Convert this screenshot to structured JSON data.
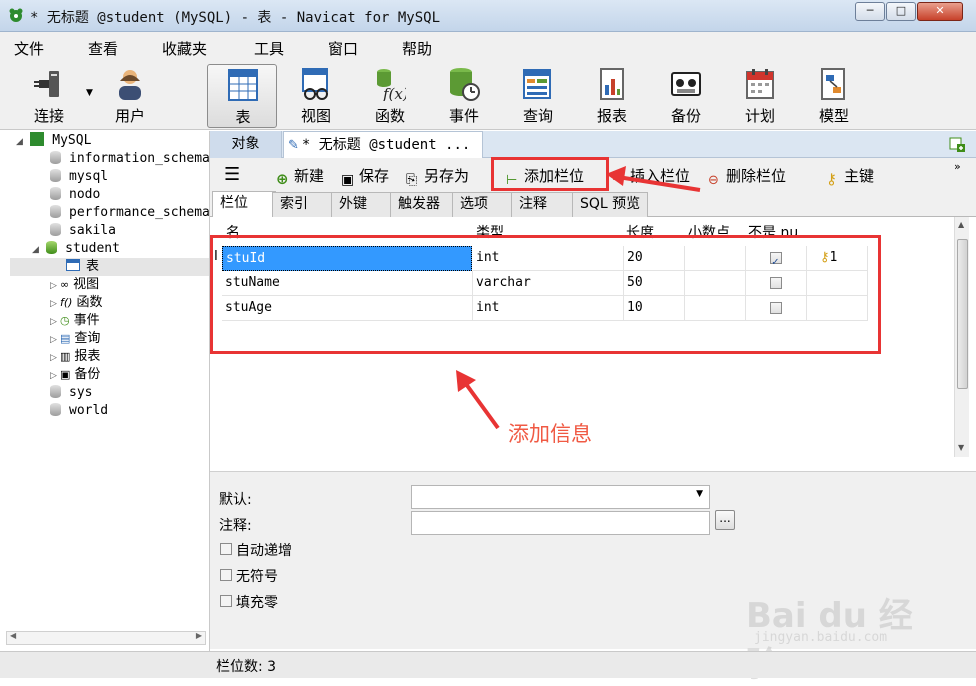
{
  "window": {
    "title": "* 无标题 @student (MySQL) - 表 - Navicat for MySQL",
    "min": "─",
    "max": "□",
    "close": "✕"
  },
  "menu": [
    "文件",
    "查看",
    "收藏夹",
    "工具",
    "窗口",
    "帮助"
  ],
  "toolbar": [
    {
      "label": "连接",
      "icon": "plug-icon"
    },
    {
      "label": "用户",
      "icon": "user-icon"
    },
    {
      "label": "表",
      "icon": "table-icon"
    },
    {
      "label": "视图",
      "icon": "view-icon"
    },
    {
      "label": "函数",
      "icon": "function-icon"
    },
    {
      "label": "事件",
      "icon": "event-icon"
    },
    {
      "label": "查询",
      "icon": "query-icon"
    },
    {
      "label": "报表",
      "icon": "report-icon"
    },
    {
      "label": "备份",
      "icon": "backup-icon"
    },
    {
      "label": "计划",
      "icon": "schedule-icon"
    },
    {
      "label": "模型",
      "icon": "model-icon"
    }
  ],
  "tree": {
    "root": "MySQL",
    "databases": [
      "information_schema",
      "mysql",
      "nodo",
      "performance_schema",
      "sakila",
      "student"
    ],
    "student_children": [
      "表",
      "视图",
      "函数",
      "事件",
      "查询",
      "报表",
      "备份"
    ],
    "after": [
      "sys",
      "world"
    ]
  },
  "tabs": {
    "objects": "对象",
    "doc": "* 无标题 @student ..."
  },
  "design_toolbar": {
    "new": "新建",
    "save": "保存",
    "save_as": "另存为",
    "add_field": "添加栏位",
    "insert_field": "插入栏位",
    "delete_field": "删除栏位",
    "primary_key": "主键"
  },
  "subtabs": [
    "栏位",
    "索引",
    "外键",
    "触发器",
    "选项",
    "注释",
    "SQL 预览"
  ],
  "grid": {
    "headers": [
      "名",
      "类型",
      "长度",
      "小数点",
      "不是 nu"
    ],
    "rows": [
      {
        "name": "stuId",
        "type": "int",
        "length": "20",
        "decimals": "",
        "not_null": true,
        "key": "1"
      },
      {
        "name": "stuName",
        "type": "varchar",
        "length": "50",
        "decimals": "",
        "not_null": false,
        "key": ""
      },
      {
        "name": "stuAge",
        "type": "int",
        "length": "10",
        "decimals": "",
        "not_null": false,
        "key": ""
      }
    ]
  },
  "annotation": {
    "text": "添加信息",
    "color": "#e83434"
  },
  "properties": {
    "default_label": "默认:",
    "comment_label": "注释:",
    "auto_increment": "自动递增",
    "unsigned": "无符号",
    "zerofill": "填充零",
    "more_button": "..."
  },
  "status": {
    "field_count": "栏位数: 3"
  },
  "watermark": {
    "text": "Bai du 经验",
    "url": "jingyan.baidu.com"
  }
}
